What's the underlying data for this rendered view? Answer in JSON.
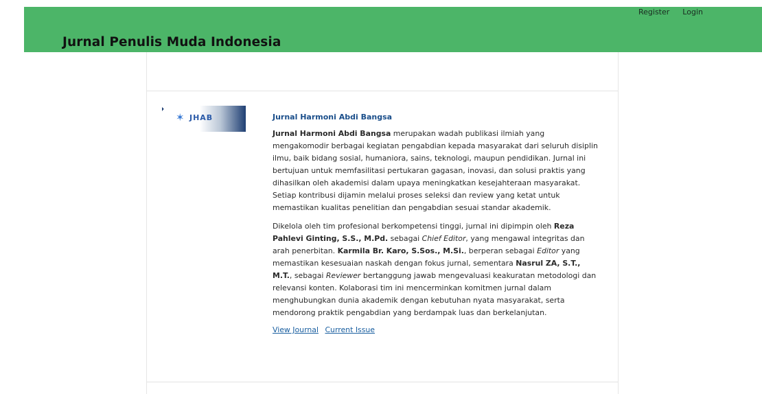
{
  "header": {
    "site_title": "Jurnal Penulis Muda Indonesia",
    "register": "Register",
    "login": "Login"
  },
  "journal": {
    "title": "Jurnal Harmoni Abdi Bangsa",
    "logo_text": "JHAB",
    "p1_name": "Jurnal Harmoni Abdi Bangsa",
    "p1_rest": " merupakan wadah publikasi ilmiah yang mengakomodir berbagai kegiatan pengabdian kepada masyarakat dari seluruh disiplin ilmu, baik bidang sosial, humaniora, sains, teknologi, maupun pendidikan. Jurnal ini bertujuan untuk memfasilitasi pertukaran gagasan, inovasi, dan solusi praktis yang dihasilkan oleh akademisi dalam upaya meningkatkan kesejahteraan masyarakat. Setiap kontribusi dijamin melalui proses seleksi dan review yang ketat untuk memastikan kualitas penelitian dan pengabdian sesuai standar akademik.",
    "p2_a": "Dikelola oleh tim profesional berkompetensi tinggi, jurnal ini dipimpin oleh ",
    "chief_name": "Reza Pahlevi Ginting, S.S., M.Pd.",
    "p2_b": " sebagai ",
    "chief_role": "Chief Editor",
    "p2_c": ", yang mengawal integritas dan arah penerbitan. ",
    "editor_name": "Karmila Br. Karo, S.Sos., M.Si.",
    "p2_d": ", berperan sebagai ",
    "editor_role": "Editor",
    "p2_e": " yang memastikan kesesuaian naskah dengan fokus jurnal, sementara ",
    "reviewer_name": "Nasrul ZA, S.T., M.T.",
    "p2_f": ", sebagai ",
    "reviewer_role": "Reviewer",
    "p2_g": " bertanggung jawab mengevaluasi keakuratan metodologi dan relevansi konten. Kolaborasi tim ini mencerminkan komitmen jurnal dalam menghubungkan dunia akademik dengan kebutuhan nyata masyarakat, serta mendorong praktik pengabdian yang berdampak luas dan berkelanjutan.",
    "view_journal": "View Journal",
    "current_issue": "Current Issue"
  },
  "colors": {
    "header_bg": "#4cb568",
    "link": "#1a5fa0",
    "title_link": "#1a4e8a"
  }
}
